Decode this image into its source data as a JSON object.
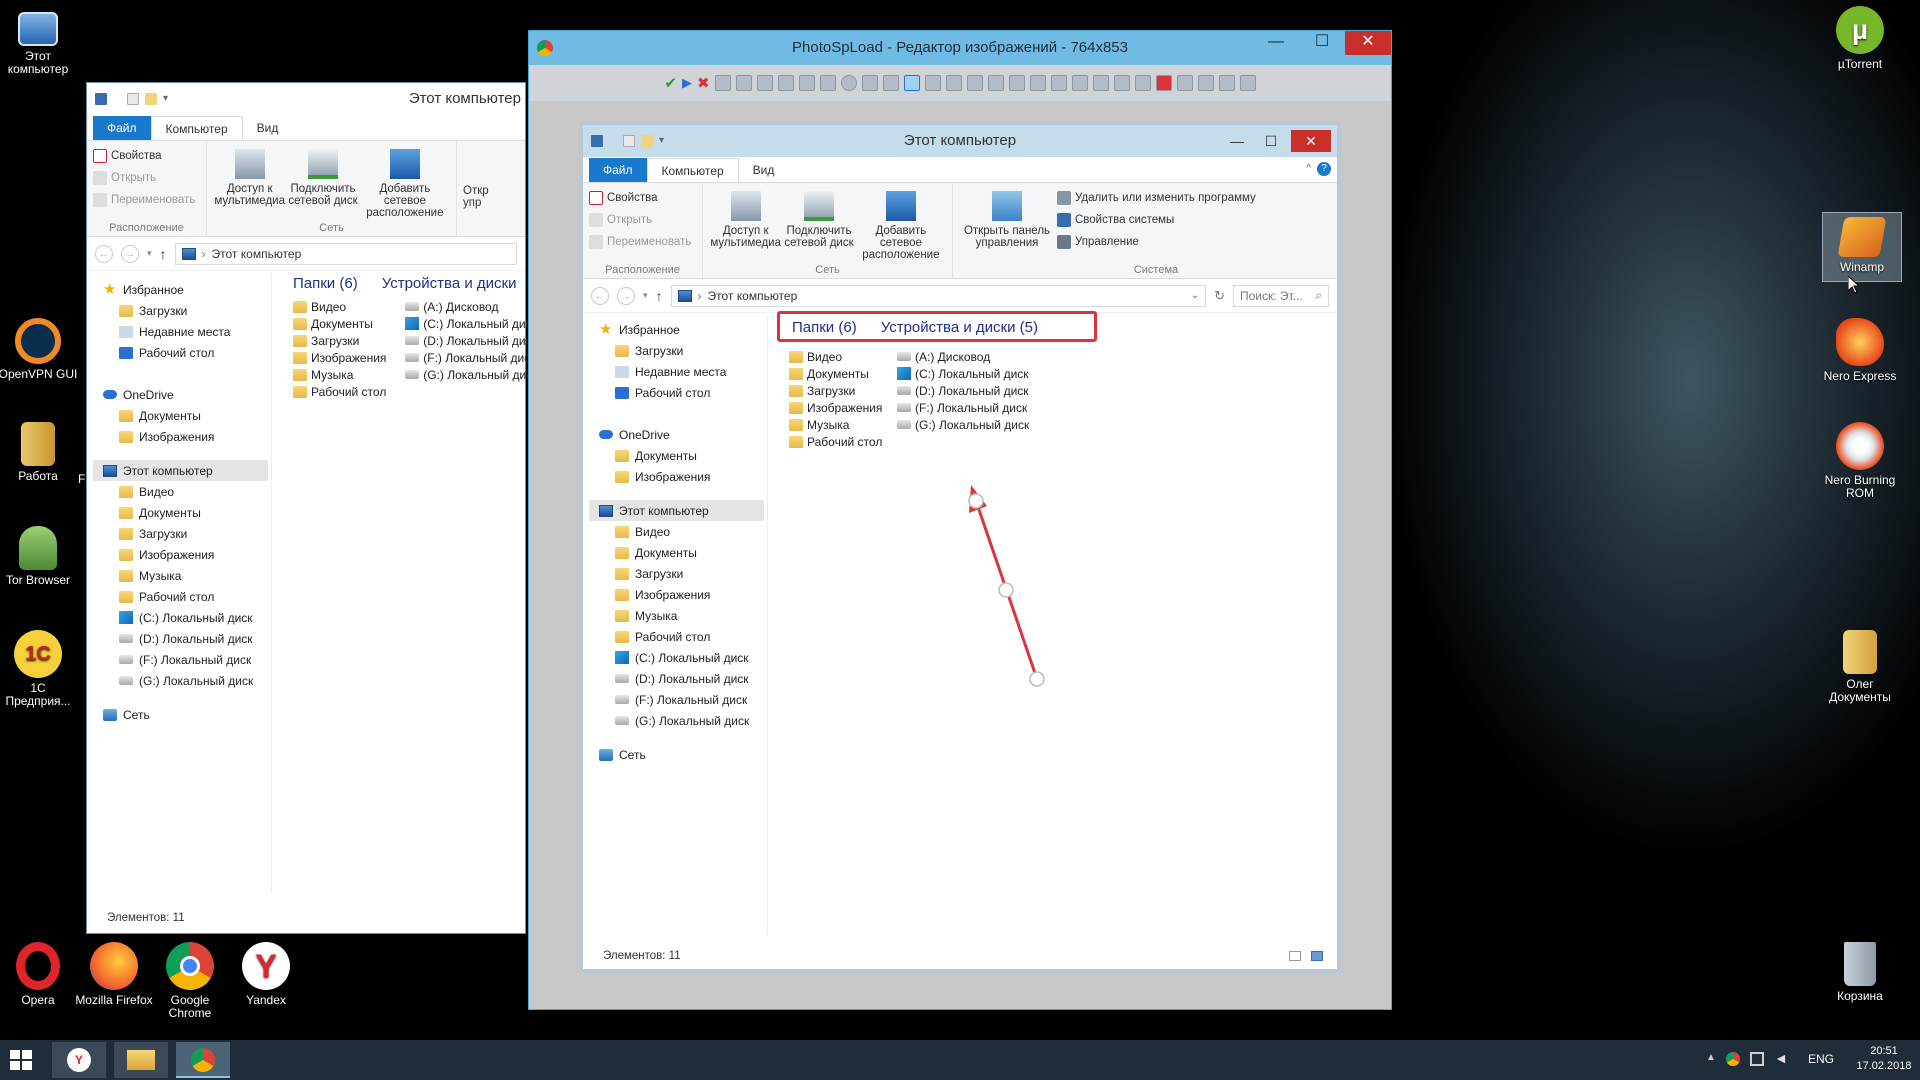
{
  "desktop": {
    "icons_left": [
      {
        "name": "this-pc-desktop-icon",
        "label": "Этот компьютер"
      },
      {
        "name": "openvpn-desktop-icon",
        "label": "OpenVPN GUI"
      },
      {
        "name": "rabota-desktop-icon",
        "label": "Работа"
      },
      {
        "name": "tor-desktop-icon",
        "label": "Tor Browser"
      },
      {
        "name": "1c-desktop-icon",
        "label": "1С Предприя..."
      },
      {
        "name": "opera-desktop-icon",
        "label": "Opera"
      },
      {
        "name": "firefox-desktop-icon",
        "label": "Mozilla Firefox"
      },
      {
        "name": "chrome-desktop-icon",
        "label": "Google Chrome"
      },
      {
        "name": "yandex-desktop-icon",
        "label": "Yandex"
      }
    ],
    "icons_right": [
      {
        "name": "utorrent-desktop-icon",
        "label": "µTorrent"
      },
      {
        "name": "winamp-desktop-icon",
        "label": "Winamp"
      },
      {
        "name": "nero-express-desktop-icon",
        "label": "Nero Express"
      },
      {
        "name": "nero-burning-desktop-icon",
        "label": "Nero Burning ROM"
      },
      {
        "name": "oleg-docs-desktop-icon",
        "label": "Олег Документы"
      },
      {
        "name": "recycle-bin-desktop-icon",
        "label": "Корзина"
      }
    ],
    "partial_label": "F"
  },
  "explorer_bg": {
    "title": "Этот компьютер",
    "tabs": [
      "Файл",
      "Компьютер",
      "Вид"
    ],
    "ribbon": {
      "properties": "Свойства",
      "open": "Открыть",
      "rename": "Переименовать",
      "location_group": "Расположение",
      "media_access": "Доступ к мультимедиа",
      "map_drive": "Подключить сетевой диск",
      "add_location": "Добавить сетевое расположение",
      "network_group": "Сеть",
      "open_cp_partial": "Откр упр"
    },
    "address": "Этот компьютер",
    "nav": {
      "favorites": "Избранное",
      "downloads": "Загрузки",
      "recent": "Недавние места",
      "desktop": "Рабочий стол",
      "onedrive": "OneDrive",
      "documents": "Документы",
      "images": "Изображения",
      "thispc": "Этот компьютер",
      "video": "Видео",
      "music": "Музыка",
      "drive_c": "(C:) Локальный диск",
      "drive_d": "(D:) Локальный диск",
      "drive_f": "(F:) Локальный диск",
      "drive_g": "(G:) Локальный диск",
      "network": "Сеть"
    },
    "content": {
      "folders_header": "Папки (6)",
      "devices_header": "Устройства и диски",
      "folders": [
        "Видео",
        "Документы",
        "Загрузки",
        "Изображения",
        "Музыка",
        "Рабочий стол"
      ],
      "drives": [
        "(A:) Дисковод",
        "(C:) Локальный диск",
        "(D:) Локальный диск",
        "(F:) Локальный диск",
        "(G:) Локальный диск"
      ]
    },
    "status": "Элементов: 11"
  },
  "photospload": {
    "title": "PhotoSpLoad - Редактор изображений - 764x853",
    "min": "—",
    "max": "☐",
    "close": "✕"
  },
  "explorer_inner": {
    "title": "Этот компьютер",
    "tabs": [
      "Файл",
      "Компьютер",
      "Вид"
    ],
    "ribbon": {
      "properties": "Свойства",
      "open": "Открыть",
      "rename": "Переименовать",
      "location_group": "Расположение",
      "media_access": "Доступ к мультимедиа",
      "map_drive": "Подключить сетевой диск",
      "add_location": "Добавить сетевое расположение",
      "network_group": "Сеть",
      "open_cp": "Открыть панель управления",
      "uninstall": "Удалить или изменить программу",
      "sys_props": "Свойства системы",
      "manage": "Управление",
      "system_group": "Система"
    },
    "address": "Этот компьютер",
    "search_placeholder": "Поиск: Эт...",
    "nav": {
      "favorites": "Избранное",
      "downloads": "Загрузки",
      "recent": "Недавние места",
      "desktop": "Рабочий стол",
      "onedrive": "OneDrive",
      "documents": "Документы",
      "images": "Изображения",
      "thispc": "Этот компьютер",
      "video": "Видео",
      "music": "Музыка",
      "drive_c": "(C:) Локальный диск",
      "drive_d": "(D:) Локальный диск",
      "drive_f": "(F:) Локальный диск",
      "drive_g": "(G:) Локальный диск",
      "network": "Сеть"
    },
    "content": {
      "folders_header": "Папки (6)",
      "devices_header": "Устройства и диски (5)",
      "folders": [
        "Видео",
        "Документы",
        "Загрузки",
        "Изображения",
        "Музыка",
        "Рабочий стол"
      ],
      "drives": [
        "(A:) Дисковод",
        "(C:) Локальный диск",
        "(D:) Локальный диск",
        "(F:) Локальный диск",
        "(G:) Локальный диск"
      ]
    },
    "status": "Элементов: 11",
    "annotation_color": "#d9353d"
  },
  "taskbar": {
    "lang": "ENG",
    "time": "20:51",
    "date": "17.02.2018"
  },
  "colors": {
    "accent": "#1979ca",
    "title_bar": "#6fbbe3",
    "annotation": "#d9353d"
  }
}
